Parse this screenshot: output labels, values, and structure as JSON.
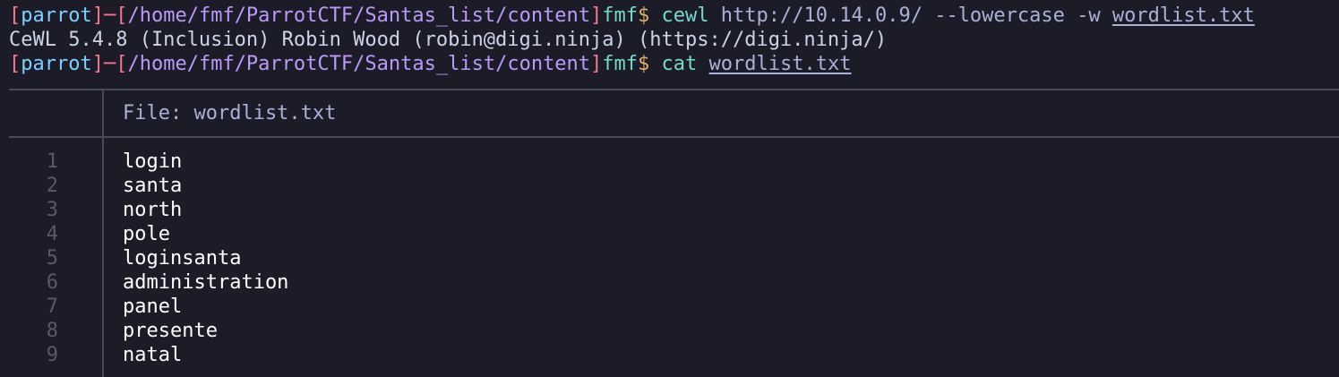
{
  "prompt": {
    "open_bracket": "[",
    "host": "parrot",
    "separator": "]─[",
    "path": "/home/fmf/ParrotCTF/Santas_list/content",
    "close_bracket": "]",
    "user": "fmf",
    "dollar": "$"
  },
  "commands": [
    {
      "cmd": "cewl",
      "args": "http://10.14.0.9/ --lowercase -w",
      "file_arg": "wordlist.txt"
    },
    {
      "cmd": "cat",
      "file_arg": "wordlist.txt"
    }
  ],
  "output": {
    "cewl_banner": "CeWL 5.4.8 (Inclusion) Robin Wood (robin@digi.ninja) (https://digi.ninja/)"
  },
  "file_view": {
    "header": "File: wordlist.txt",
    "lines": [
      {
        "num": "1",
        "text": "login"
      },
      {
        "num": "2",
        "text": "santa"
      },
      {
        "num": "3",
        "text": "north"
      },
      {
        "num": "4",
        "text": "pole"
      },
      {
        "num": "5",
        "text": "loginsanta"
      },
      {
        "num": "6",
        "text": "administration"
      },
      {
        "num": "7",
        "text": "panel"
      },
      {
        "num": "8",
        "text": "presente"
      },
      {
        "num": "9",
        "text": "natal"
      }
    ]
  },
  "colors": {
    "background": "#1c1c28",
    "bracket": "#f7768e",
    "host": "#7dcfff",
    "path": "#bb9af7",
    "user": "#73daca",
    "dollar": "#e0af68",
    "line_number": "#5a5a66",
    "rule": "#4a4a55"
  }
}
